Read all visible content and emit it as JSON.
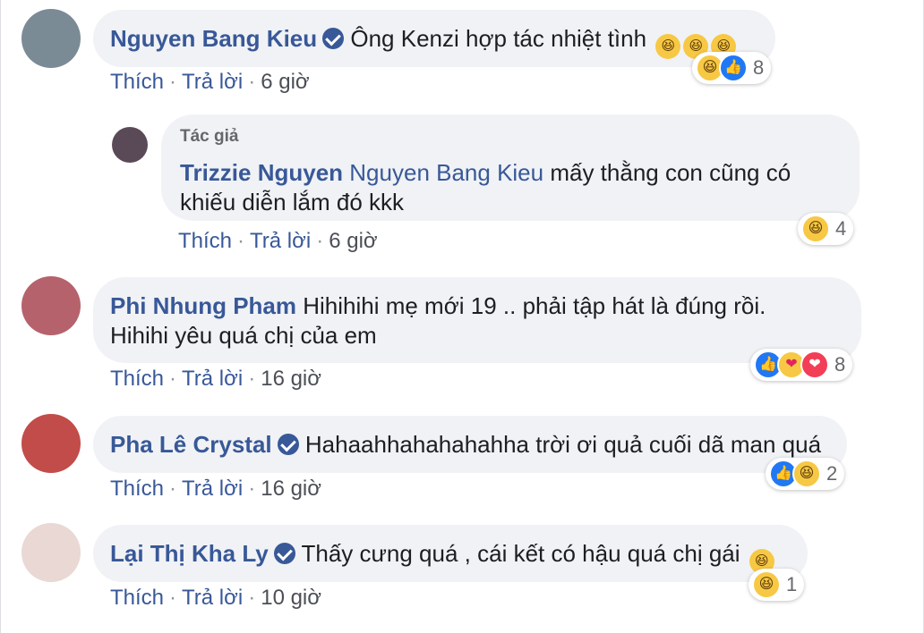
{
  "actions": {
    "like": "Thích",
    "reply": "Trả lời",
    "dot": "·"
  },
  "comments": [
    {
      "name": "Nguyen Bang Kieu",
      "verified": true,
      "text": "Ông Kenzi hợp tác nhiệt tình",
      "inline_emoji": [
        "rolling-laughing",
        "rolling-laughing",
        "rolling-laughing"
      ],
      "time": "6 giờ",
      "reactions": {
        "icons": [
          "haha",
          "like"
        ],
        "count": "8"
      }
    },
    {
      "author_tag": "Tác giả",
      "name": "Trizzie Nguyen",
      "mention": "Nguyen Bang Kieu",
      "text": "mấy thằng con cũng có",
      "text2": "khiếu diễn lắm đó kkk",
      "time": "6 giờ",
      "reactions": {
        "icons": [
          "haha"
        ],
        "count": "4"
      }
    },
    {
      "name": "Phi Nhung Pham",
      "text": "Hihihihi mẹ mới 19 .. phải tập hát là đúng rồi.",
      "text2": "Hihihi yêu quá chị của em",
      "time": "16 giờ",
      "reactions": {
        "icons": [
          "like",
          "care",
          "love"
        ],
        "count": "8"
      }
    },
    {
      "name": "Pha Lê Crystal",
      "verified": true,
      "text": "Hahaahhahahahahha trời ơi quả cuối dã man quá",
      "time": "16 giờ",
      "reactions": {
        "icons": [
          "like",
          "haha"
        ],
        "count": "2"
      }
    },
    {
      "name": "Lại Thị Kha Ly",
      "verified": true,
      "text": "Thấy cưng quá , cái kết có hậu quá chị gái",
      "inline_emoji": [
        "rolling-laughing"
      ],
      "time": "10 giờ",
      "reactions": {
        "icons": [
          "haha"
        ],
        "count": "1"
      }
    }
  ],
  "colors": {
    "name": "#385898",
    "bubble": "#f0f2f5",
    "like": "#2078f4",
    "love": "#f33e58",
    "haha": "#f7c844"
  }
}
